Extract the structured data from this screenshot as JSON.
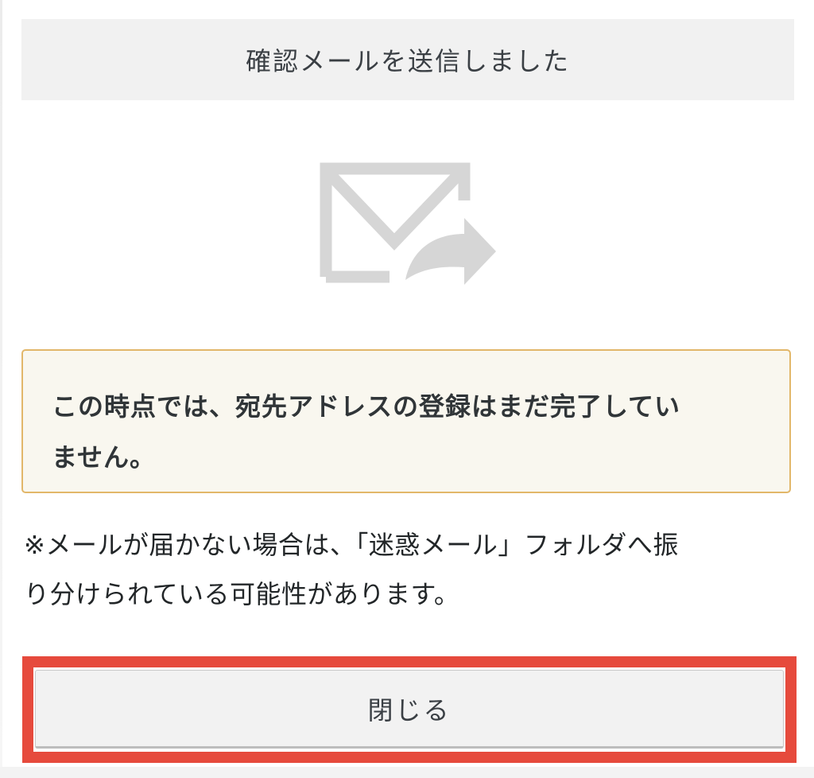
{
  "header": {
    "title": "確認メールを送信しました"
  },
  "icon": {
    "name": "mail-send-icon",
    "color": "#d6d6d6"
  },
  "notice": {
    "line1": "この時点では、宛先アドレスの登録はまだ完了してい",
    "line2": "ません。"
  },
  "info": {
    "line1": "※メールが届かない場合は、「迷惑メール」フォルダへ振",
    "line2": "り分けられている可能性があります。"
  },
  "close_button": {
    "label": "閉じる",
    "highlight_color": "#e64a3c"
  }
}
